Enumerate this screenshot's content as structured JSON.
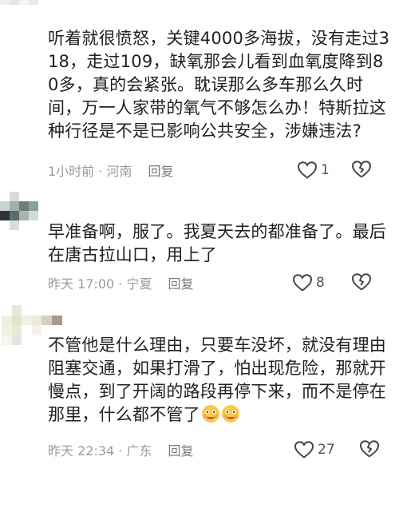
{
  "comments": [
    {
      "text": "听着就很愤怒，关键4000多海拔，没有走过318，走过109，缺氧那会儿看到血氧度降到80多，真的会紧张。耽误那么多车那么久时间，万一人家带的氧气不够怎么办！特斯拉这种行径是不是已影响公共安全，涉嫌违法?",
      "time": "1小时前 · 河南",
      "reply": "回复",
      "likes": "1"
    },
    {
      "text": "早准备啊，服了。我夏天去的都准备了。最后在唐古拉山口，用上了",
      "time": "昨天 17:00 · 宁夏",
      "reply": "回复",
      "likes": "8"
    },
    {
      "text": "不管他是什么理由，只要车没坏，就没有理由阻塞交通，如果打滑了，怕出现危险，那就开慢点，到了开阔的路段再停下来，而不是停在那里，什么都不管了",
      "time": "昨天 22:34 · 广东",
      "reply": "回复",
      "likes": "27"
    }
  ],
  "icons": {
    "like": "heart-outline-icon",
    "dislike": "broken-heart-icon",
    "emoji": "nervous-face-emoji"
  }
}
